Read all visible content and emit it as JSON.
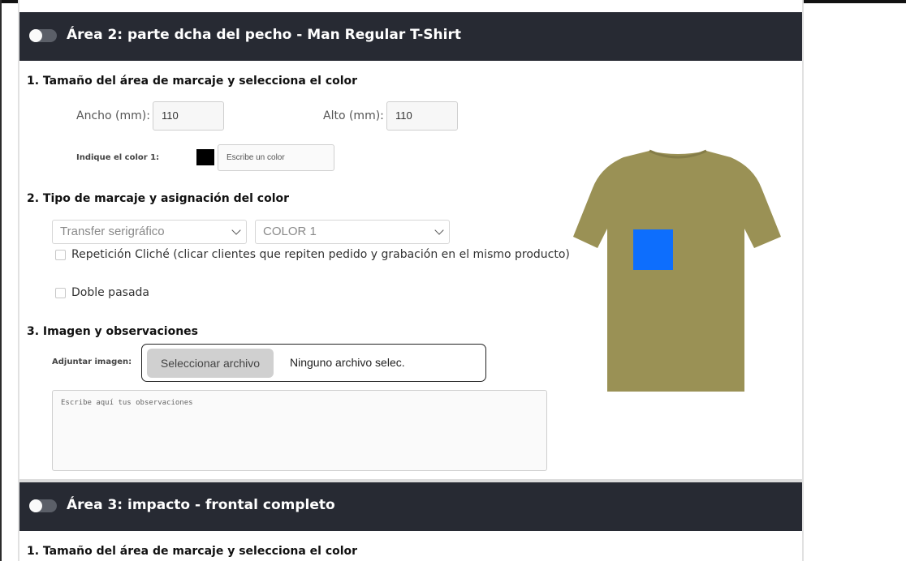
{
  "areas": [
    {
      "title": "Área 2: parte dcha del pecho - Man Regular T-Shirt",
      "section1_title": "1. Tamaño del área de marcaje y selecciona el color",
      "width_label": "Ancho (mm):",
      "width_value": "110",
      "height_label": "Alto (mm):",
      "height_value": "110",
      "color_label": "Indique el color 1:",
      "color_swatch": "#000000",
      "color_placeholder": "Escribe un color",
      "section2_title": "2. Tipo de marcaje y asignación del color",
      "marking_type": "Transfer serigráfico",
      "color_select": "COLOR 1",
      "repeat_cliche_label": "Repetición Cliché (clicar clientes que repiten pedido y grabación en el mismo producto)",
      "double_pass_label": "Doble pasada",
      "section3_title": "3. Imagen y observaciones",
      "attach_label": "Adjuntar imagen:",
      "file_button": "Seleccionar archivo",
      "file_status": "Ninguno archivo selec.",
      "observations_placeholder": "Escribe aquí tus observaciones",
      "preview": {
        "shirt_color": "#9a9155",
        "mark_color": "#0d6efd"
      }
    },
    {
      "title": "Área 3: impacto - frontal completo",
      "section1_title": "1. Tamaño del área de marcaje y selecciona el color"
    }
  ]
}
